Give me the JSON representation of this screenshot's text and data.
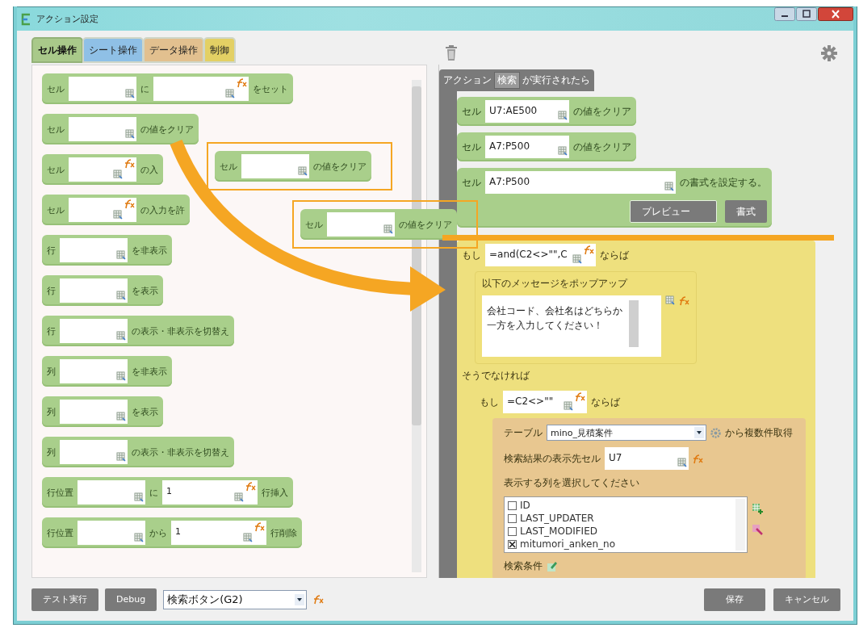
{
  "window": {
    "title": "アクション設定"
  },
  "tabs": [
    {
      "label": "セル操作",
      "selected": true,
      "color": "#a9c98a"
    },
    {
      "label": "シート操作",
      "selected": false,
      "color": "#8fc0e6"
    },
    {
      "label": "データ操作",
      "selected": false,
      "color": "#e2c08f"
    },
    {
      "label": "制御",
      "selected": false,
      "color": "#e3d064"
    }
  ],
  "palette": [
    {
      "parts": [
        {
          "kind": "label",
          "text": "セル"
        },
        {
          "kind": "field",
          "formula": false
        },
        {
          "kind": "label",
          "text": "に"
        },
        {
          "kind": "wide-field",
          "formula": true
        },
        {
          "kind": "label",
          "text": "をセット"
        }
      ]
    },
    {
      "parts": [
        {
          "kind": "label",
          "text": "セル"
        },
        {
          "kind": "field",
          "formula": false
        },
        {
          "kind": "label",
          "text": "の値をクリア"
        }
      ]
    },
    {
      "parts": [
        {
          "kind": "label",
          "text": "セル"
        },
        {
          "kind": "field",
          "formula": true
        },
        {
          "kind": "label",
          "text": "の入"
        }
      ]
    },
    {
      "parts": [
        {
          "kind": "label",
          "text": "セル"
        },
        {
          "kind": "field",
          "formula": true
        },
        {
          "kind": "label",
          "text": "の入力を許"
        }
      ]
    },
    {
      "parts": [
        {
          "kind": "label",
          "text": "行"
        },
        {
          "kind": "field",
          "formula": false
        },
        {
          "kind": "label",
          "text": "を非表示"
        }
      ]
    },
    {
      "parts": [
        {
          "kind": "label",
          "text": "行"
        },
        {
          "kind": "field",
          "formula": false
        },
        {
          "kind": "label",
          "text": "を表示"
        }
      ]
    },
    {
      "parts": [
        {
          "kind": "label",
          "text": "行"
        },
        {
          "kind": "field",
          "formula": false
        },
        {
          "kind": "label",
          "text": "の表示・非表示を切替え"
        }
      ]
    },
    {
      "parts": [
        {
          "kind": "label",
          "text": "列"
        },
        {
          "kind": "field",
          "formula": false
        },
        {
          "kind": "label",
          "text": "を非表示"
        }
      ]
    },
    {
      "parts": [
        {
          "kind": "label",
          "text": "列"
        },
        {
          "kind": "field",
          "formula": false
        },
        {
          "kind": "label",
          "text": "を表示"
        }
      ]
    },
    {
      "parts": [
        {
          "kind": "label",
          "text": "列"
        },
        {
          "kind": "field",
          "formula": false
        },
        {
          "kind": "label",
          "text": "の表示・非表示を切替え"
        }
      ]
    },
    {
      "parts": [
        {
          "kind": "label",
          "text": "行位置"
        },
        {
          "kind": "field",
          "formula": false
        },
        {
          "kind": "label",
          "text": "に"
        },
        {
          "kind": "wide-field",
          "value": "1",
          "formula": true
        },
        {
          "kind": "label",
          "text": "行挿入"
        }
      ]
    },
    {
      "parts": [
        {
          "kind": "label",
          "text": "行位置"
        },
        {
          "kind": "field",
          "formula": false
        },
        {
          "kind": "label",
          "text": "から"
        },
        {
          "kind": "wide-field",
          "value": "1",
          "formula": true
        },
        {
          "kind": "label",
          "text": "行削除"
        }
      ]
    }
  ],
  "drag_ghosts": [
    {
      "parts": [
        {
          "kind": "label",
          "text": "セル"
        },
        {
          "kind": "field",
          "formula": false
        },
        {
          "kind": "label",
          "text": "の値をクリア"
        }
      ]
    },
    {
      "parts": [
        {
          "kind": "label",
          "text": "セル"
        },
        {
          "kind": "field",
          "formula": false
        },
        {
          "kind": "label",
          "text": "の値をクリア"
        }
      ]
    }
  ],
  "script": {
    "trigger": {
      "prefix": "アクション",
      "chip": "検索",
      "suffix": "が実行されたら"
    },
    "steps": [
      {
        "kind": "cell",
        "parts": [
          {
            "kind": "label",
            "text": "セル"
          },
          {
            "kind": "field",
            "value": "U7:AE500",
            "formula": false
          },
          {
            "kind": "label",
            "text": "の値をクリア"
          }
        ]
      },
      {
        "kind": "cell",
        "parts": [
          {
            "kind": "label",
            "text": "セル"
          },
          {
            "kind": "field",
            "value": "A7:P500",
            "formula": false
          },
          {
            "kind": "label",
            "text": "の値をクリア"
          }
        ]
      },
      {
        "kind": "format",
        "parts": [
          {
            "kind": "label",
            "text": "セル"
          },
          {
            "kind": "xwide-field",
            "value": "A7:P500",
            "formula": false
          },
          {
            "kind": "label",
            "text": "の書式を設定する。"
          }
        ],
        "buttons": [
          "プレビュー",
          "書式"
        ]
      },
      {
        "kind": "if",
        "parts": [
          {
            "kind": "label",
            "text": "もし"
          },
          {
            "kind": "field",
            "value": "=and(C2<>\"\",C",
            "formula": true
          },
          {
            "kind": "label",
            "text": "ならば"
          }
        ],
        "then": [
          {
            "kind": "popup",
            "title": "以下のメッセージをポップアップ",
            "message": "会社コード、会社名はどちらか一方を入力してください！"
          }
        ],
        "else_label": "そうでなければ",
        "else": [
          {
            "kind": "if",
            "parts": [
              {
                "kind": "label",
                "text": "もし"
              },
              {
                "kind": "field",
                "value": "=C2<>\"\"",
                "formula": true
              },
              {
                "kind": "label",
                "text": "ならば"
              }
            ],
            "then": [
              {
                "kind": "table-fetch",
                "table_label": "テーブル",
                "table": "mino_見積案件",
                "suffix": "から複数件取得",
                "dest_label": "検索結果の表示先セル",
                "dest": "U7",
                "columns_label": "表示する列を選択してください",
                "columns": [
                  {
                    "name": "ID",
                    "checked": false
                  },
                  {
                    "name": "LAST_UPDATER",
                    "checked": false
                  },
                  {
                    "name": "LAST_MODIFIED",
                    "checked": false
                  },
                  {
                    "name": "mitumori_anken_no",
                    "checked": true
                  }
                ],
                "condition_label": "検索条件"
              }
            ]
          }
        ]
      }
    ]
  },
  "footer": {
    "left_buttons": [
      "テスト実行",
      "Debug"
    ],
    "action_select": "検索ボタン(G2)",
    "right_buttons": [
      "保存",
      "キャンセル"
    ]
  }
}
